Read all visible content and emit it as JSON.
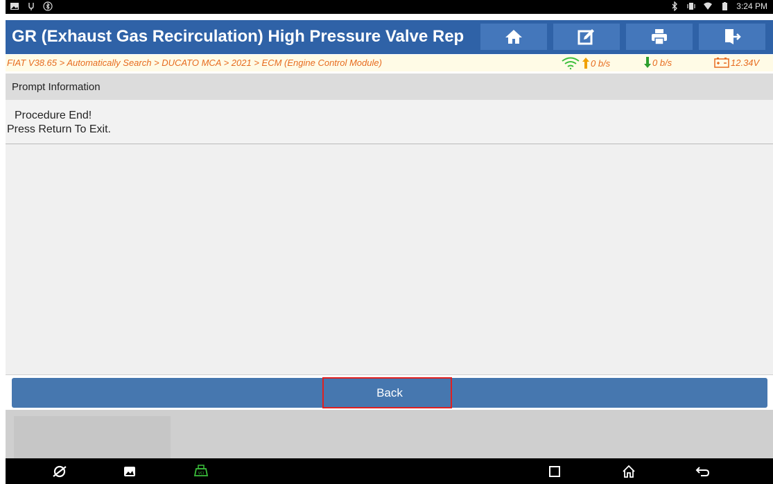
{
  "status_bar": {
    "time": "3:24 PM",
    "left_icons": [
      "gallery-notification-icon",
      "usb-icon",
      "bluetooth-settings-icon"
    ],
    "right_icons": [
      "bluetooth-icon",
      "vibrate-icon",
      "wifi-icon",
      "battery-icon"
    ]
  },
  "titlebar": {
    "title": "GR (Exhaust Gas Recirculation) High Pressure Valve Rep",
    "buttons": [
      "home-icon",
      "edit-icon",
      "print-icon",
      "exit-icon"
    ],
    "color": "#2f62a7",
    "button_color": "#4477bb"
  },
  "breadcrumb": {
    "path": "FIAT V38.65 > Automatically Search > DUCATO MCA > 2021 > ECM (Engine Control Module)",
    "upload_rate": "0 b/s",
    "download_rate": "0 b/s",
    "voltage": "12.34V",
    "text_color": "#e76b1e"
  },
  "prompt": {
    "header": "Prompt Information",
    "line1": "Procedure End!",
    "line2": "Press Return To Exit."
  },
  "actions": {
    "back_label": "Back",
    "button_color": "#4677af"
  },
  "navbar": {
    "icons": [
      "browser-icon",
      "gallery-icon",
      "vci-icon",
      "recents-icon",
      "home-nav-icon",
      "back-nav-icon"
    ]
  }
}
